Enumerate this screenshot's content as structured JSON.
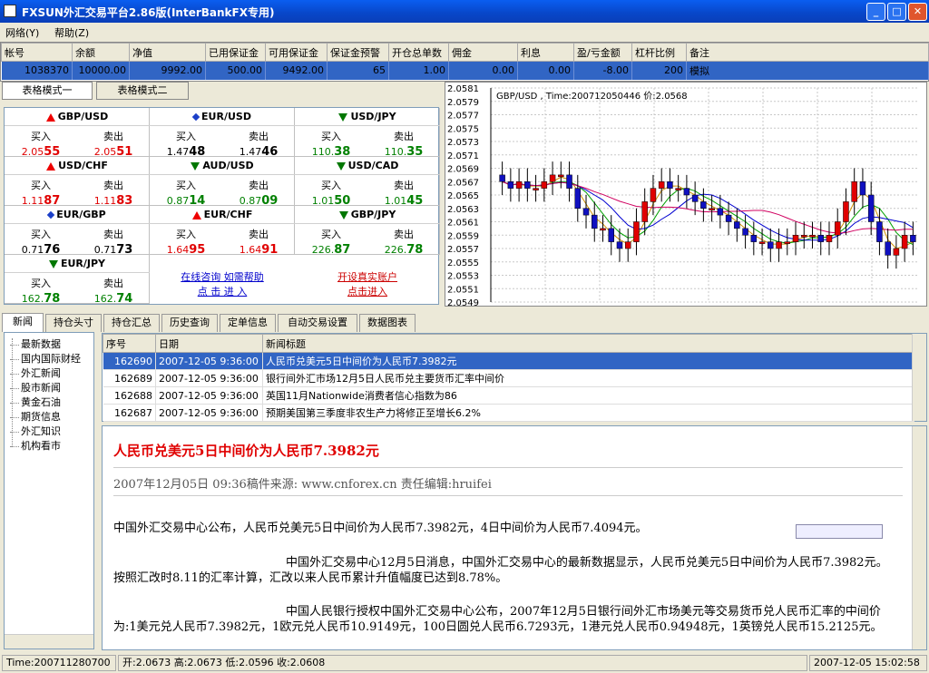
{
  "window": {
    "title": "FXSUN外汇交易平台2.86版(InterBankFX专用)"
  },
  "menu": {
    "items": [
      "网络(Y)",
      "帮助(Z)"
    ]
  },
  "account": {
    "headers": [
      "帐号",
      "余额",
      "净值",
      "已用保证金",
      "可用保证金",
      "保证金预警",
      "开仓总单数",
      "佣金",
      "利息",
      "盈/亏金额",
      "杠杆比例",
      "备注"
    ],
    "row": [
      "1038370",
      "10000.00",
      "9992.00",
      "500.00",
      "9492.00",
      "65",
      "1.00",
      "0.00",
      "0.00",
      "-8.00",
      "200",
      "模拟"
    ]
  },
  "quote_tabs": [
    "表格模式一",
    "表格模式二"
  ],
  "quote_labels": {
    "buy": "买入",
    "sell": "卖出"
  },
  "quotes": [
    {
      "pair": "GBP/USD",
      "dir": "up",
      "buy_pre": "2.05",
      "buy_big": "55",
      "sell_pre": "2.05",
      "sell_big": "51"
    },
    {
      "pair": "EUR/USD",
      "dir": "neu",
      "buy_pre": "1.47",
      "buy_big": "48",
      "sell_pre": "1.47",
      "sell_big": "46"
    },
    {
      "pair": "USD/JPY",
      "dir": "dn",
      "buy_pre": "110.",
      "buy_big": "38",
      "sell_pre": "110.",
      "sell_big": "35"
    },
    {
      "pair": "USD/CHF",
      "dir": "up",
      "buy_pre": "1.11",
      "buy_big": "87",
      "sell_pre": "1.11",
      "sell_big": "83"
    },
    {
      "pair": "AUD/USD",
      "dir": "dn",
      "buy_pre": "0.87",
      "buy_big": "14",
      "sell_pre": "0.87",
      "sell_big": "09"
    },
    {
      "pair": "USD/CAD",
      "dir": "dn",
      "buy_pre": "1.01",
      "buy_big": "50",
      "sell_pre": "1.01",
      "sell_big": "45"
    },
    {
      "pair": "EUR/GBP",
      "dir": "neu",
      "buy_pre": "0.71",
      "buy_big": "76",
      "sell_pre": "0.71",
      "sell_big": "73"
    },
    {
      "pair": "EUR/CHF",
      "dir": "up",
      "buy_pre": "1.64",
      "buy_big": "95",
      "sell_pre": "1.64",
      "sell_big": "91"
    },
    {
      "pair": "GBP/JPY",
      "dir": "dn",
      "buy_pre": "226.",
      "buy_big": "87",
      "sell_pre": "226.",
      "sell_big": "78"
    },
    {
      "pair": "EUR/JPY",
      "dir": "dn",
      "buy_pre": "162.",
      "buy_big": "78",
      "sell_pre": "162.",
      "sell_big": "74"
    }
  ],
  "links": {
    "consult_line1": "在线咨询 如需帮助",
    "consult_line2": "点 击 进 入",
    "open_line1": "开设真实账户",
    "open_line2": "点击进入"
  },
  "chart_data": {
    "type": "candlestick",
    "title": "GBP/USD , Time:200712050446 价:2.0568",
    "y_ticks": [
      "2.0581",
      "2.0579",
      "2.0577",
      "2.0575",
      "2.0573",
      "2.0571",
      "2.0569",
      "2.0567",
      "2.0565",
      "2.0563",
      "2.0561",
      "2.0559",
      "2.0557",
      "2.0555",
      "2.0553",
      "2.0551",
      "2.0549"
    ],
    "ylim": [
      2.0549,
      2.0581
    ],
    "close": [
      2.0567,
      2.0566,
      2.0567,
      2.0566,
      2.0566,
      2.0567,
      2.0568,
      2.0568,
      2.0566,
      2.0563,
      2.0562,
      2.056,
      2.056,
      2.0558,
      2.0557,
      2.0558,
      2.0561,
      2.0564,
      2.0566,
      2.0567,
      2.0566,
      2.0566,
      2.0565,
      2.0564,
      2.0563,
      2.0563,
      2.0562,
      2.0561,
      2.056,
      2.0559,
      2.0558,
      2.0558,
      2.0557,
      2.0558,
      2.0558,
      2.0559,
      2.0559,
      2.0559,
      2.0558,
      2.0559,
      2.0561,
      2.0564,
      2.0567,
      2.0565,
      2.0561,
      2.0558,
      2.0556,
      2.0557,
      2.0559,
      2.0558
    ]
  },
  "bottom_tabs": [
    "新闻",
    "持仓头寸",
    "持仓汇总",
    "历史查询",
    "定单信息",
    "自动交易设置",
    "数据图表"
  ],
  "tree": [
    "最新数据",
    "国内国际财经",
    "外汇新闻",
    "股市新闻",
    "黄金石油",
    "期货信息",
    "外汇知识",
    "机构看市"
  ],
  "news": {
    "headers": [
      "序号",
      "日期",
      "新闻标题"
    ],
    "rows": [
      [
        "162690",
        "2007-12-05 9:36:00",
        "人民币兑美元5日中间价为人民币7.3982元"
      ],
      [
        "162689",
        "2007-12-05 9:36:00",
        "银行间外汇市场12月5日人民币兑主要货币汇率中间价"
      ],
      [
        "162688",
        "2007-12-05 9:36:00",
        "英国11月Nationwide消费者信心指数为86"
      ],
      [
        "162687",
        "2007-12-05 9:36:00",
        "预期美国第三季度非农生产力将修正至增长6.2%"
      ]
    ]
  },
  "article": {
    "title": "人民币兑美元5日中间价为人民币7.3982元",
    "meta": "2007年12月05日  09:36稿件来源: www.cnforex.cn 责任编辑:hruifei",
    "p1": "中国外汇交易中心公布，人民币兑美元5日中间价为人民币7.3982元，4日中间价为人民币7.4094元。",
    "p2": "中国外汇交易中心12月5日消息，中国外汇交易中心的最新数据显示，人民币兑美元5日中间价为人民币7.3982元。按照汇改时8.11的汇率计算，汇改以来人民币累计升值幅度已达到8.78%。",
    "p3": "中国人民银行授权中国外汇交易中心公布，2007年12月5日银行间外汇市场美元等交易货币兑人民币汇率的中间价为:1美元兑人民币7.3982元，1欧元兑人民币10.9149元，100日圆兑人民币6.7293元，1港元兑人民币0.94948元，1英镑兑人民币15.2125元。"
  },
  "status": {
    "time": "Time:200711280700",
    "ohlc": "开:2.0673 高:2.0673 低:2.0596 收:2.0608",
    "clock": "2007-12-05 15:02:58"
  }
}
